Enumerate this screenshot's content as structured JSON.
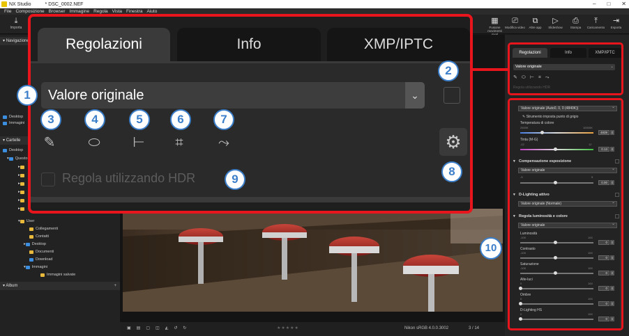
{
  "app": {
    "title": "NX Studio",
    "file": "* DSC_0002.NEF",
    "window_controls": [
      "–",
      "□",
      "✕"
    ]
  },
  "menu": [
    "File",
    "Composizione",
    "Browser",
    "Immagine",
    "Regola",
    "Vista",
    "Finestra",
    "Aiuto"
  ],
  "toolbar": {
    "left_label": "Importa",
    "right_items": [
      {
        "label": "Fusione movimenti pixel",
        "icon": "pixel-shift-icon"
      },
      {
        "label": "Modifica video",
        "icon": "video-edit-icon"
      },
      {
        "label": "Altre app",
        "icon": "apps-icon"
      },
      {
        "label": "Slideshow",
        "icon": "slideshow-icon"
      },
      {
        "label": "Stampa",
        "icon": "print-icon"
      },
      {
        "label": "Caricamento",
        "icon": "upload-icon"
      },
      {
        "label": "Esporta",
        "icon": "export-icon"
      }
    ]
  },
  "left_panel": {
    "sections": {
      "navigation": "Navigazione",
      "folders": "Cartelle",
      "album": "Album"
    },
    "favorites": [
      "Desktop",
      "Immagini"
    ],
    "tree": [
      {
        "label": "Desktop",
        "level": 0
      },
      {
        "label": "Questo PC",
        "level": 1
      },
      {
        "label": "User",
        "level": 2
      },
      {
        "label": "Collegamenti",
        "level": 3
      },
      {
        "label": "Contatti",
        "level": 3
      },
      {
        "label": "Desktop",
        "level": 3
      },
      {
        "label": "Documenti",
        "level": 3
      },
      {
        "label": "Download",
        "level": 3
      },
      {
        "label": "Immagini",
        "level": 3
      },
      {
        "label": "Immagini salvate",
        "level": 4
      }
    ]
  },
  "bottom_bar": {
    "profile": "Nikon sRGB 4.0.0.3002",
    "page": "3 / 14"
  },
  "enlarged": {
    "tabs": [
      "Regolazioni",
      "Info",
      "XMP/IPTC"
    ],
    "active_tab": 0,
    "preset": "Valore originale",
    "hdr_label": "Regola utilizzando HDR",
    "icons": [
      "eyedropper-icon",
      "retouch-brush-icon",
      "tone-curve-icon",
      "crop-icon",
      "straighten-icon"
    ]
  },
  "badges": [
    "1",
    "2",
    "3",
    "4",
    "5",
    "6",
    "7",
    "8",
    "9",
    "10"
  ],
  "panel": {
    "tabs": [
      "Regolazioni",
      "Info",
      "XMP/IPTC"
    ],
    "preset": "Valore originale",
    "hdr_label": "Regola utilizzando HDR",
    "wb_select": "Valore originale (Auto0, 0, 0 (4840K))",
    "grey_point_label": "Strumento imposta punto di grigio",
    "temp_label": "Temperatura di colore",
    "temp_min": "2500K",
    "temp_max": "10000K",
    "temp_value": "4839",
    "temp_level": 0.31,
    "tint_label": "Tinta (M-G)",
    "tint_min": "-12",
    "tint_max": "12",
    "tint_value": "0.13",
    "tint_level": 0.5,
    "exposure": {
      "title": "Compensazione esposizione",
      "select": "Valore originale",
      "min": "-5",
      "max": "5",
      "value": "0.00",
      "level": 0.5
    },
    "dlighting": {
      "title": "D-Lighting attivo",
      "select": "Valore originale (Normale)"
    },
    "brightness": {
      "title": "Regola luminosità e colore",
      "select": "Valore originale",
      "sliders": [
        {
          "label": "Luminosità",
          "min": "-100",
          "max": "100",
          "value": "0",
          "level": 0.5
        },
        {
          "label": "Contrasto",
          "min": "-100",
          "max": "100",
          "value": "0",
          "level": 0.5
        },
        {
          "label": "Saturazione",
          "min": "-100",
          "max": "100",
          "value": "0",
          "level": 0.5
        },
        {
          "label": "Alte-luci",
          "min": "0",
          "max": "100",
          "value": "0",
          "level": 0
        },
        {
          "label": "Ombre",
          "min": "0",
          "max": "100",
          "value": "0",
          "level": 0
        },
        {
          "label": "D-Lighting HS",
          "min": "0",
          "max": "100",
          "value": "0",
          "level": 0
        }
      ]
    }
  },
  "colors": {
    "callout": "#e8151d",
    "badge_blue": "#3b7ec9"
  }
}
